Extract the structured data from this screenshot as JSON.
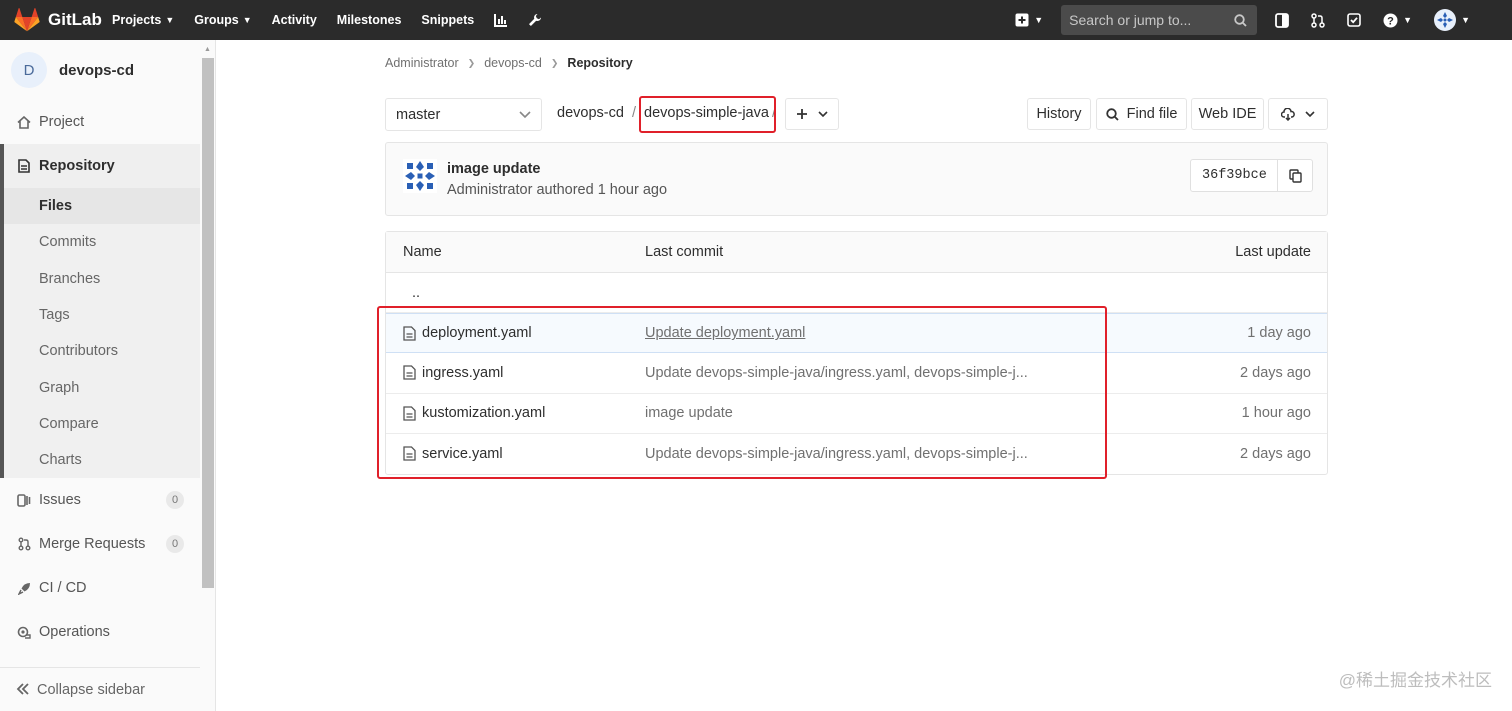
{
  "navbar": {
    "brand": "GitLab",
    "links": [
      {
        "label": "Projects",
        "dropdown": true
      },
      {
        "label": "Groups",
        "dropdown": true
      },
      {
        "label": "Activity",
        "dropdown": false
      },
      {
        "label": "Milestones",
        "dropdown": false
      },
      {
        "label": "Snippets",
        "dropdown": false
      }
    ],
    "search_placeholder": "Search or jump to...",
    "icons": [
      "chart-icon",
      "wrench-icon",
      "plus-square-icon",
      "search-icon",
      "sidebar-toggle-icon",
      "merge-request-icon",
      "todo-check-icon",
      "help-icon",
      "user-avatar"
    ]
  },
  "sidebar": {
    "project_initial": "D",
    "project_name": "devops-cd",
    "items": {
      "project": "Project",
      "repository": "Repository",
      "issues": "Issues",
      "issues_count": "0",
      "merge_requests": "Merge Requests",
      "merge_requests_count": "0",
      "cicd": "CI / CD",
      "operations": "Operations"
    },
    "repository_sub": [
      "Files",
      "Commits",
      "Branches",
      "Tags",
      "Contributors",
      "Graph",
      "Compare",
      "Charts"
    ],
    "collapse": "Collapse sidebar"
  },
  "breadcrumb": {
    "items": [
      "Administrator",
      "devops-cd",
      "Repository"
    ]
  },
  "toolbar": {
    "branch": "master",
    "path_root": "devops-cd",
    "separator": "/",
    "path_dir": "devops-simple-java",
    "history": "History",
    "find_file": "Find file",
    "web_ide": "Web IDE"
  },
  "last_commit": {
    "title": "image update",
    "meta": "Administrator authored 1 hour ago",
    "sha": "36f39bce"
  },
  "tree": {
    "headers": {
      "name": "Name",
      "last_commit": "Last commit",
      "last_update": "Last update"
    },
    "parent": "..",
    "rows": [
      {
        "name": "deployment.yaml",
        "commit": "Update deployment.yaml",
        "updated": "1 day ago"
      },
      {
        "name": "ingress.yaml",
        "commit": "Update devops-simple-java/ingress.yaml, devops-simple-j...",
        "updated": "2 days ago"
      },
      {
        "name": "kustomization.yaml",
        "commit": "image update",
        "updated": "1 hour ago"
      },
      {
        "name": "service.yaml",
        "commit": "Update devops-simple-java/ingress.yaml, devops-simple-j...",
        "updated": "2 days ago"
      }
    ]
  },
  "watermark": "@稀土掘金技术社区",
  "colors": {
    "navbar": "#2b2b2b",
    "highlight_red": "#e0202a",
    "brand_orange": "#fc6d26"
  }
}
